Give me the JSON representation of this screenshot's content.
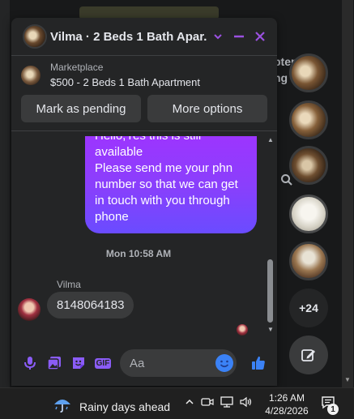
{
  "chat": {
    "title": "Vilma · 2 Beds 1 Bath Apar...",
    "marketplace_label": "Marketplace",
    "listing_title": "$500 - 2 Beds 1 Bath Apartment",
    "mark_pending_label": "Mark as pending",
    "more_options_label": "More options",
    "outgoing_message": "Hello,Yes this is still\navailable\nPlease send me your phn\nnumber so that we can get\nin touch with you through\nphone",
    "timestamp": "Mon 10:58 AM",
    "sender_name": "Vilma",
    "incoming_message": "8148064183",
    "input_placeholder": "Aa",
    "accent_color": "#9b51e0",
    "icons": [
      "chevron-down-icon",
      "minimize-icon",
      "close-icon",
      "microphone-icon",
      "photo-icon",
      "sticker-icon",
      "gif-icon",
      "emoji-icon",
      "thumbs-up-icon"
    ]
  },
  "background": {
    "partial_text_line1": "pter",
    "partial_text_line2": "ng"
  },
  "rail": {
    "more_count": "+24",
    "compose_icon": "new-message-icon"
  },
  "taskbar": {
    "weather_text": "Rainy days ahead",
    "time": "1:26 AM",
    "date": "4/28/2026",
    "notification_count": "1"
  }
}
